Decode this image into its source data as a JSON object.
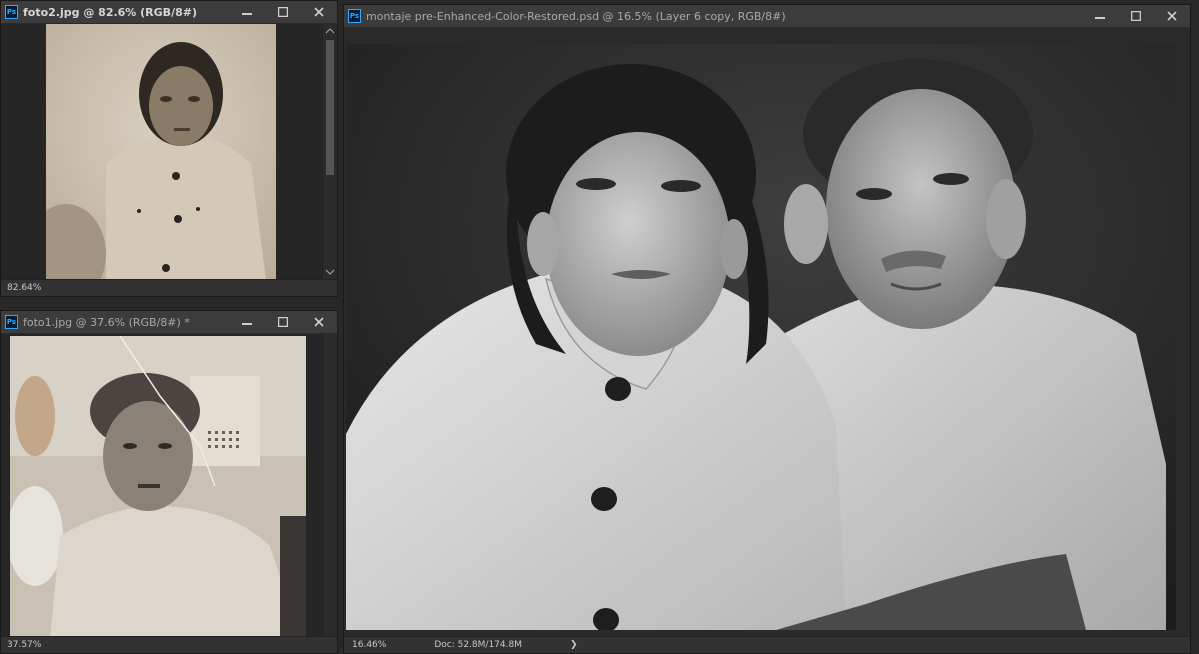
{
  "window_foto2": {
    "title": "foto2.jpg @ 82.6% (RGB/8#)",
    "zoom": "82.64%"
  },
  "window_foto1": {
    "title": "foto1.jpg @ 37.6% (RGB/8#) *",
    "zoom": "37.57%"
  },
  "window_main": {
    "title": "montaje pre-Enhanced-Color-Restored.psd @ 16.5% (Layer 6 copy, RGB/8#)",
    "zoom": "16.46%",
    "doc_info": "Doc: 52.8M/174.8M",
    "status_arrow": "❯"
  },
  "icons": {
    "app": "photoshop-icon",
    "minimize": "minimize-icon",
    "maximize": "maximize-icon",
    "close": "close-icon"
  },
  "app_icon_text": "Ps"
}
